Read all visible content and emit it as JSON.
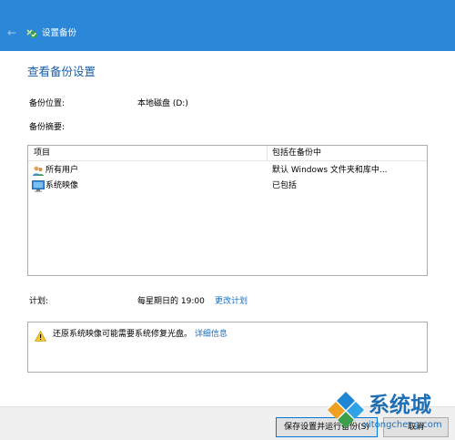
{
  "window": {
    "title": "设置备份",
    "back_icon": "back-arrow-icon",
    "app_icon": "backup-icon",
    "titlebar_color": "#2b88d8"
  },
  "heading": "查看备份设置",
  "backup_location": {
    "label": "备份位置:",
    "value": "本地磁盘 (D:)"
  },
  "backup_summary": {
    "label": "备份摘要:",
    "columns": [
      "项目",
      "包括在备份中"
    ],
    "rows": [
      {
        "icon": "users-icon",
        "name": "所有用户",
        "included": "默认 Windows 文件夹和库中..."
      },
      {
        "icon": "monitor-icon",
        "name": "系统映像",
        "included": "已包括"
      }
    ]
  },
  "schedule": {
    "label": "计划:",
    "value": "每星期日的 19:00",
    "link": "更改计划"
  },
  "notice": {
    "icon": "warning-icon",
    "text": "还原系统映像可能需要系统修复光盘。",
    "link": "详细信息"
  },
  "buttons": {
    "save": "保存设置并运行备份(S)",
    "cancel": "取消"
  },
  "watermark": {
    "name": "系统城",
    "url": "xitongcheng.com"
  },
  "colors": {
    "accent": "#2b88d8",
    "heading": "#1a5ea8",
    "link": "#1a6fc4"
  }
}
